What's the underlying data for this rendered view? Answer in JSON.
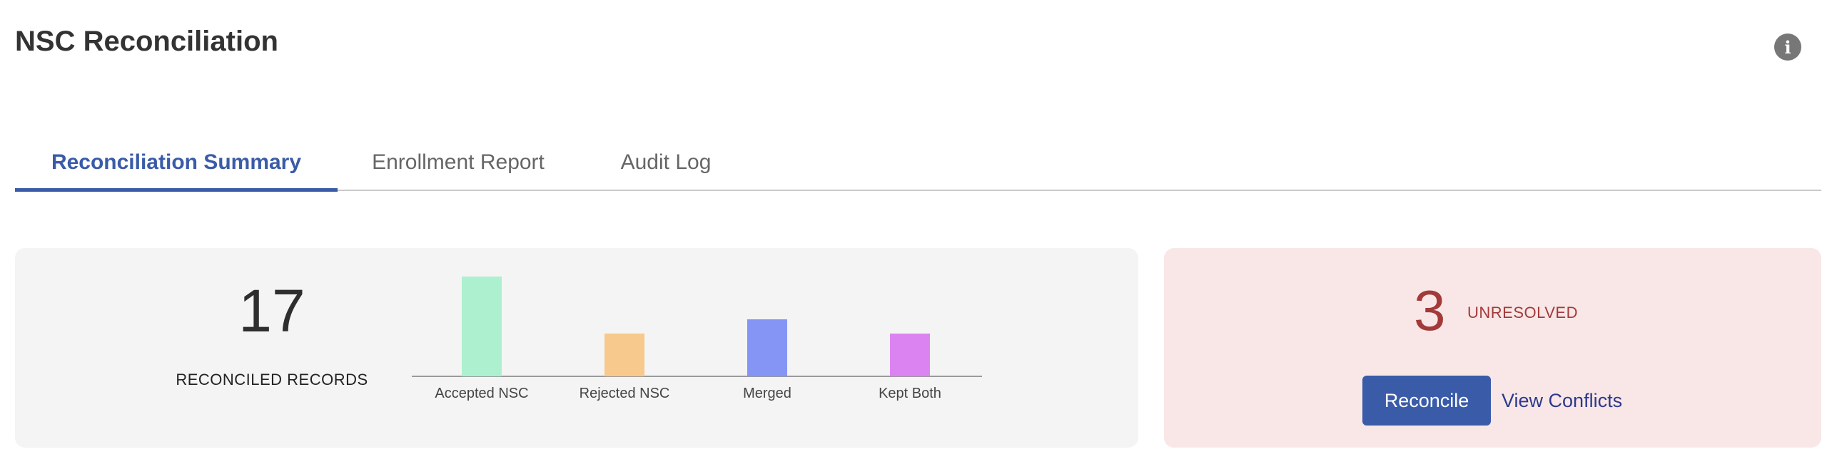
{
  "header": {
    "title": "NSC Reconciliation",
    "info_icon": "info-icon"
  },
  "tabs": [
    {
      "label": "Reconciliation Summary",
      "active": true
    },
    {
      "label": "Enrollment Report",
      "active": false
    },
    {
      "label": "Audit Log",
      "active": false
    }
  ],
  "summary": {
    "count": "17",
    "count_label": "RECONCILED RECORDS"
  },
  "unresolved": {
    "count": "3",
    "label": "UNRESOLVED",
    "reconcile_label": "Reconcile",
    "view_conflicts_label": "View Conflicts"
  },
  "colors": {
    "accent": "#3a5ba8",
    "unresolved_text": "#a33a3a",
    "unresolved_bg": "#f9e7e7",
    "summary_bg": "#f4f4f4"
  },
  "chart_data": {
    "type": "bar",
    "categories": [
      "Accepted NSC",
      "Rejected NSC",
      "Merged",
      "Kept Both"
    ],
    "values": [
      7,
      3,
      4,
      3
    ],
    "colors": [
      "#adf0cf",
      "#f7c98c",
      "#8595f5",
      "#dc83f2"
    ],
    "title": "",
    "xlabel": "",
    "ylabel": "",
    "ylim": [
      0,
      7
    ],
    "grid": false,
    "legend": "none"
  }
}
